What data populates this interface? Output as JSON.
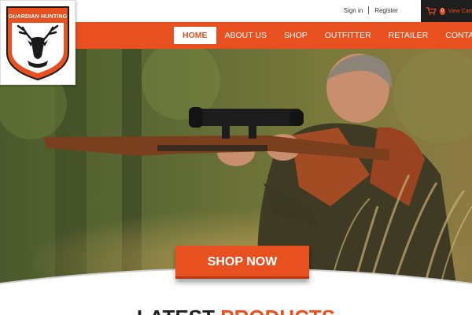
{
  "brand": {
    "name": "GUARDIAN HUNTING"
  },
  "topbar": {
    "sign_in": "Sign in",
    "register": "Register",
    "cart_count": "0",
    "cart_label": "View Cart"
  },
  "nav": {
    "items": [
      {
        "label": "HOME",
        "active": true
      },
      {
        "label": "ABOUT US"
      },
      {
        "label": "SHOP"
      },
      {
        "label": "OUTFITTER"
      },
      {
        "label": "RETAILER"
      },
      {
        "label": "CONTACT US"
      }
    ]
  },
  "hero": {
    "cta_label": "SHOP NOW"
  },
  "section": {
    "heading_part1": "LATEST",
    "heading_part2": "PRODUCTS"
  },
  "colors": {
    "accent": "#e8511f",
    "dark": "#1e1e1e"
  },
  "icons": {
    "cart": "cart-icon",
    "logo": "deer-head-icon"
  }
}
